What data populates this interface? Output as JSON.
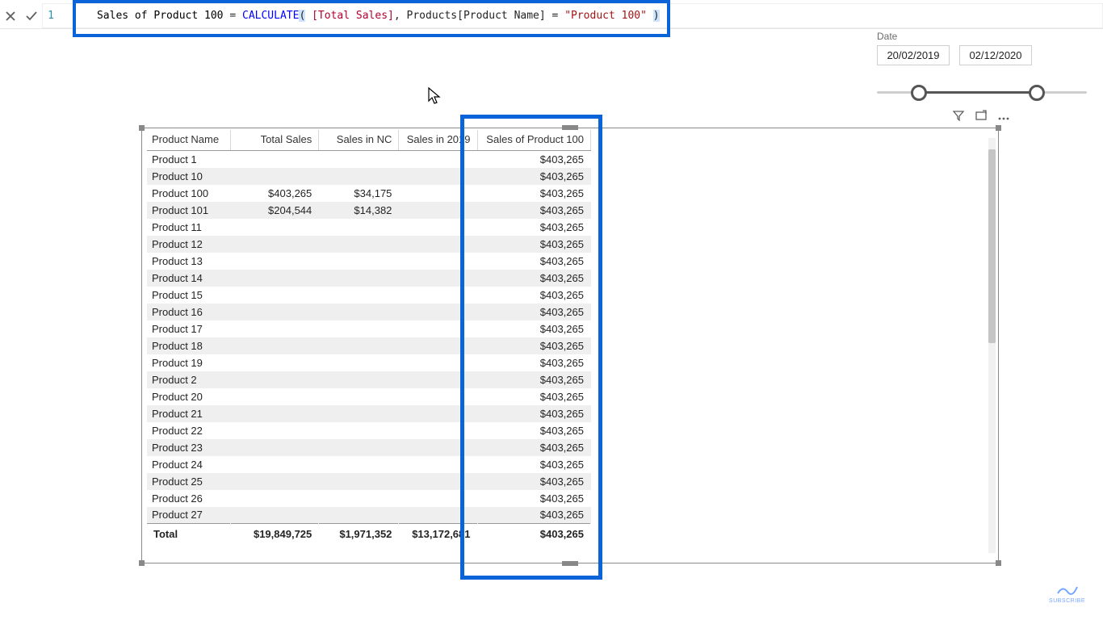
{
  "formula": {
    "line": "1",
    "measure": "Sales of Product 100",
    "func": "CALCULATE",
    "inner_ref": "[Total Sales]",
    "col_ref": "Products[Product Name]",
    "string": "\"Product 100\""
  },
  "slicer": {
    "label": "Date",
    "start": "20/02/2019",
    "end": "02/12/2020"
  },
  "table": {
    "columns": [
      "Product Name",
      "Total Sales",
      "Sales in NC",
      "Sales in 2019",
      "Sales of Product 100"
    ],
    "rows": [
      {
        "name": "Product 1",
        "total": "",
        "nc": "",
        "y2019": "",
        "sp100": "$403,265"
      },
      {
        "name": "Product 10",
        "total": "",
        "nc": "",
        "y2019": "",
        "sp100": "$403,265"
      },
      {
        "name": "Product 100",
        "total": "$403,265",
        "nc": "$34,175",
        "y2019": "",
        "sp100": "$403,265"
      },
      {
        "name": "Product 101",
        "total": "$204,544",
        "nc": "$14,382",
        "y2019": "",
        "sp100": "$403,265"
      },
      {
        "name": "Product 11",
        "total": "",
        "nc": "",
        "y2019": "",
        "sp100": "$403,265"
      },
      {
        "name": "Product 12",
        "total": "",
        "nc": "",
        "y2019": "",
        "sp100": "$403,265"
      },
      {
        "name": "Product 13",
        "total": "",
        "nc": "",
        "y2019": "",
        "sp100": "$403,265"
      },
      {
        "name": "Product 14",
        "total": "",
        "nc": "",
        "y2019": "",
        "sp100": "$403,265"
      },
      {
        "name": "Product 15",
        "total": "",
        "nc": "",
        "y2019": "",
        "sp100": "$403,265"
      },
      {
        "name": "Product 16",
        "total": "",
        "nc": "",
        "y2019": "",
        "sp100": "$403,265"
      },
      {
        "name": "Product 17",
        "total": "",
        "nc": "",
        "y2019": "",
        "sp100": "$403,265"
      },
      {
        "name": "Product 18",
        "total": "",
        "nc": "",
        "y2019": "",
        "sp100": "$403,265"
      },
      {
        "name": "Product 19",
        "total": "",
        "nc": "",
        "y2019": "",
        "sp100": "$403,265"
      },
      {
        "name": "Product 2",
        "total": "",
        "nc": "",
        "y2019": "",
        "sp100": "$403,265"
      },
      {
        "name": "Product 20",
        "total": "",
        "nc": "",
        "y2019": "",
        "sp100": "$403,265"
      },
      {
        "name": "Product 21",
        "total": "",
        "nc": "",
        "y2019": "",
        "sp100": "$403,265"
      },
      {
        "name": "Product 22",
        "total": "",
        "nc": "",
        "y2019": "",
        "sp100": "$403,265"
      },
      {
        "name": "Product 23",
        "total": "",
        "nc": "",
        "y2019": "",
        "sp100": "$403,265"
      },
      {
        "name": "Product 24",
        "total": "",
        "nc": "",
        "y2019": "",
        "sp100": "$403,265"
      },
      {
        "name": "Product 25",
        "total": "",
        "nc": "",
        "y2019": "",
        "sp100": "$403,265"
      },
      {
        "name": "Product 26",
        "total": "",
        "nc": "",
        "y2019": "",
        "sp100": "$403,265"
      },
      {
        "name": "Product 27",
        "total": "",
        "nc": "",
        "y2019": "",
        "sp100": "$403,265"
      }
    ],
    "total": {
      "label": "Total",
      "total": "$19,849,725",
      "nc": "$1,971,352",
      "y2019": "$13,172,681",
      "sp100": "$403,265"
    }
  },
  "watermark": "SUBSCRIBE"
}
